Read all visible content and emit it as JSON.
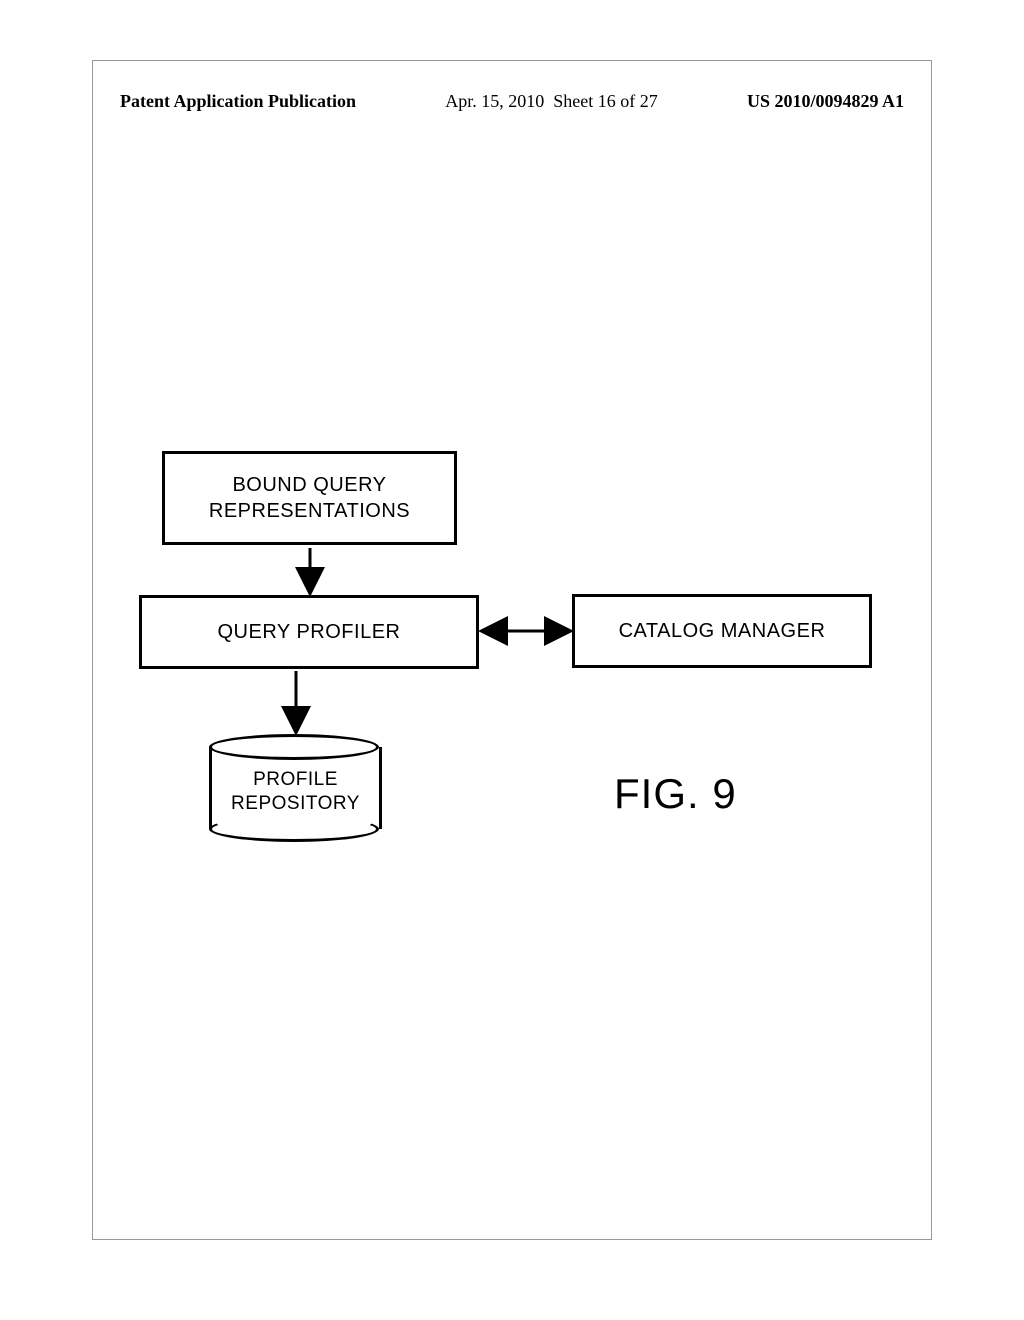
{
  "header": {
    "pub": "Patent Application Publication",
    "date": "Apr. 15, 2010",
    "sheet": "Sheet 16 of 27",
    "pubno": "US 2010/0094829 A1"
  },
  "boxes": {
    "bound": "BOUND QUERY\nREPRESENTATIONS",
    "profiler": "QUERY PROFILER",
    "catalog": "CATALOG MANAGER"
  },
  "cylinder": {
    "label": "PROFILE\nREPOSITORY"
  },
  "figure_label": "FIG. 9"
}
